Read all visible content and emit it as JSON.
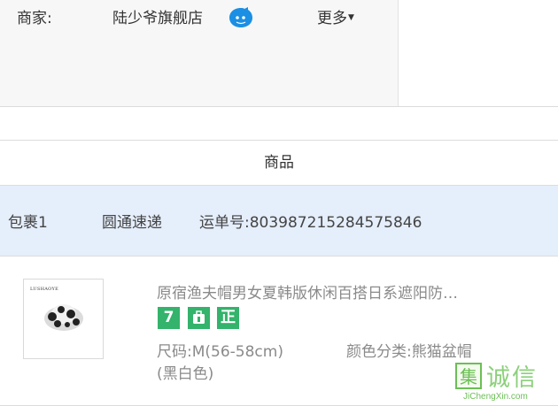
{
  "merchant": {
    "label": "商家:",
    "store_name": "陆少爷旗舰店",
    "more": "更多"
  },
  "goods_header": "商品",
  "package": {
    "name": "包裹1",
    "courier": "圆通速递",
    "tracking": "运单号:803987215284575846"
  },
  "product": {
    "thumb_brand": "LUSHAOYE",
    "title": "原宿渔夫帽男女夏韩版休闲百搭日系遮阳防…",
    "badges": [
      "7",
      "",
      "正"
    ],
    "size_spec": "尺码:M(56-58cm)",
    "color_spec": "颜色分类:熊猫盆帽",
    "color_spec_cont": "(黑白色)",
    "badge_color": "#33b36b"
  },
  "watermark": {
    "icon_char": "集",
    "text": "诚信",
    "url": "JiChengXin.com"
  },
  "colors": {
    "package_bar_bg": "#e5eefb",
    "chat_icon": "#1a8fe3"
  }
}
